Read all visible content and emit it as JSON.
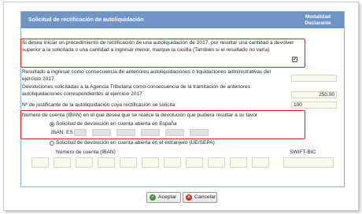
{
  "header": {
    "title": "Solicitud de rectificación de autoliquidación",
    "column_label": "Modalidad Declarante"
  },
  "rows": {
    "intro": {
      "text": "Si desea iniciar un procedimiento de rectificación de una autoliquidación de 2017, por resultar una cantidad a devolver superior a la solicitada o una cantidad a ingresar menor, marque la casilla (También si el resultado no varía)",
      "checked": true,
      "check_mark": "✔"
    },
    "resultado": {
      "text": "Resultado a ingresar como consecuencia de anteriores autoliquidaciones o liquidaciones administrativas del ejercicio 2017",
      "value": ""
    },
    "devoluciones": {
      "text": "Devoluciones solicitadas a la Agencia Tributaria como consecuencia de la tramitación de anteriores autoliquidaciones correspondientes al ejercicio 2017",
      "value": "250,00"
    },
    "justificante": {
      "text": "Nº de justificante de la autoliquidación cuya rectificación se solicita",
      "value": "100"
    }
  },
  "iban": {
    "question": "Número de cuenta (IBAN) en el que desea que se realice la devolución que pudiera resultar a su favor",
    "option_spain": "Solicitud de devolución en cuenta abierta en España",
    "option_spain_selected": true,
    "iban_label": "IBAN: ES",
    "option_abroad": "Solicitud de devolución en cuenta abierta en el extranjero (UE/SEPA)",
    "account_label": "Número de cuenta (IBAN)",
    "swift_label": "SWIFT-BIC"
  },
  "buttons": {
    "accept": "Aceptar",
    "cancel": "Cancelar"
  },
  "colors": {
    "header_bg": "#6f94c8",
    "highlight": "#e02020",
    "field_bg": "#faf9ec",
    "accept_icon": "#3d9a2e",
    "cancel_icon": "#d2302a"
  }
}
